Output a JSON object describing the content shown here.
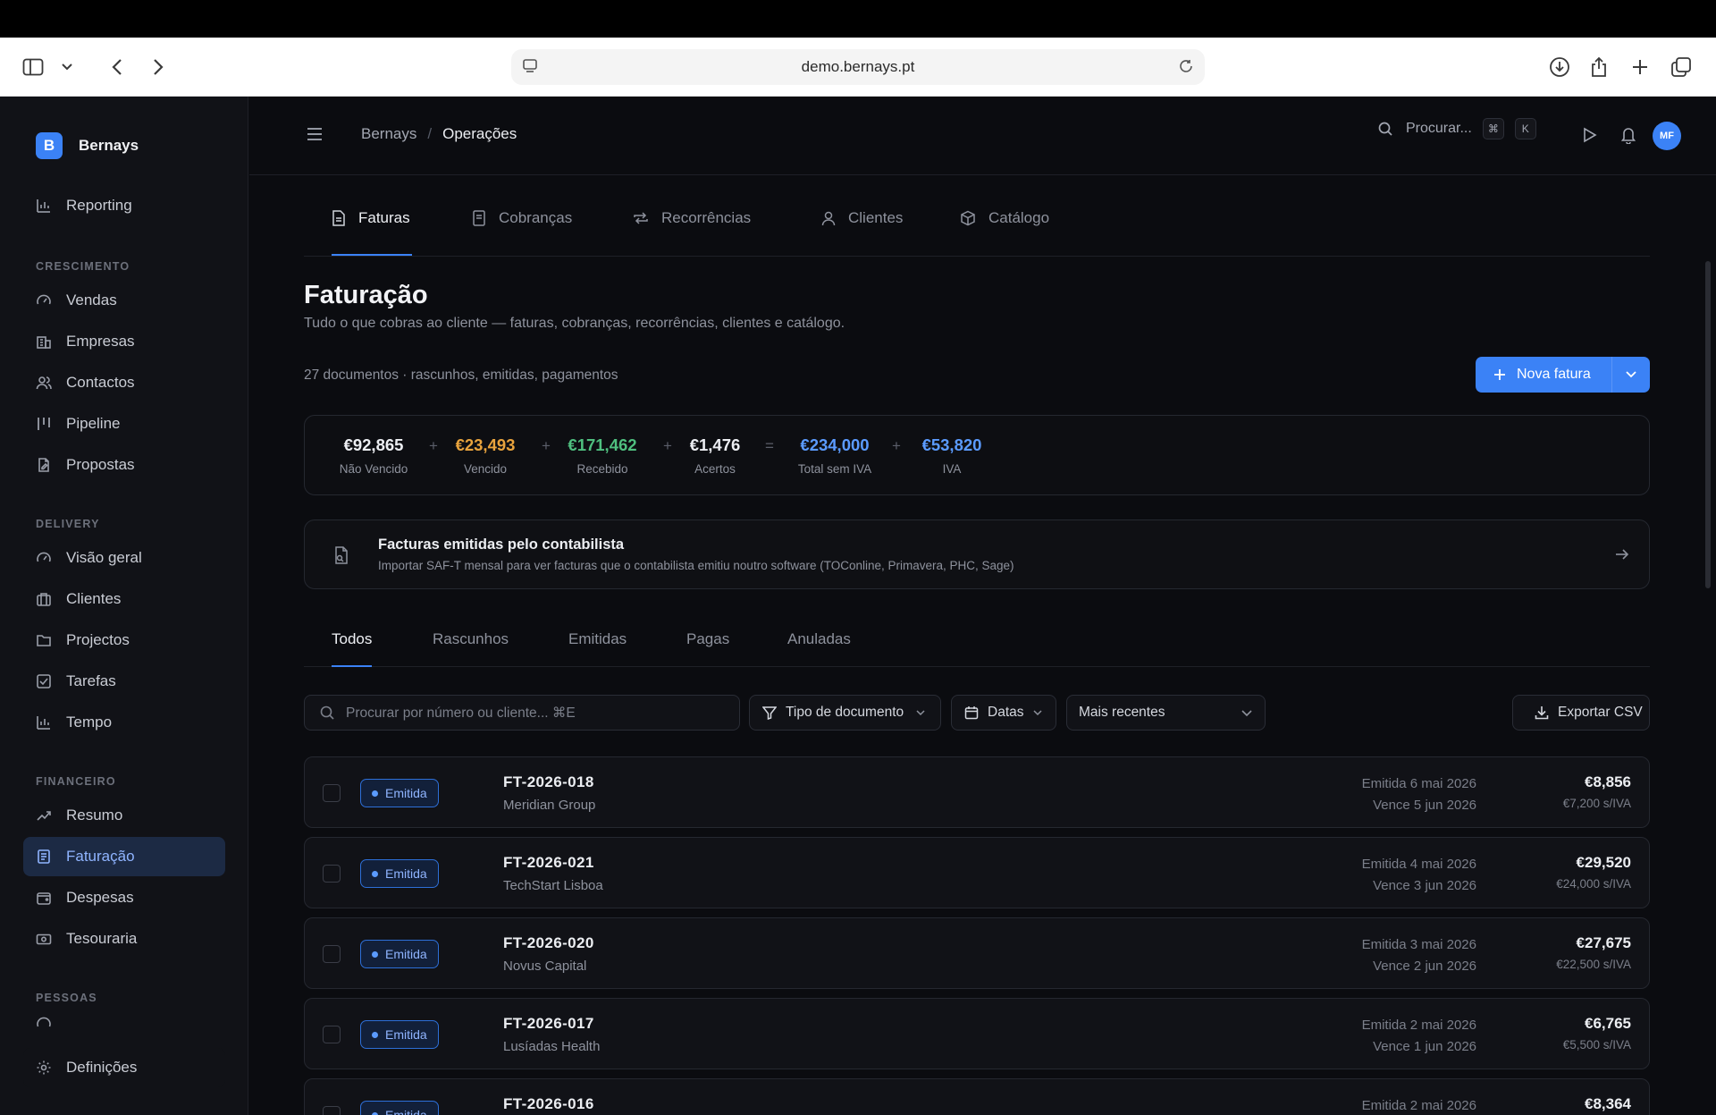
{
  "browser": {
    "url": "demo.bernays.pt"
  },
  "brand": {
    "initial": "B",
    "name": "Bernays"
  },
  "sidebar": {
    "top_items": [
      {
        "label": "Reporting",
        "icon": "bar-chart-icon"
      }
    ],
    "sections": [
      {
        "title": "CRESCIMENTO",
        "items": [
          {
            "label": "Vendas",
            "icon": "gauge-icon"
          },
          {
            "label": "Empresas",
            "icon": "building-icon"
          },
          {
            "label": "Contactos",
            "icon": "users-icon"
          },
          {
            "label": "Pipeline",
            "icon": "kanban-icon"
          },
          {
            "label": "Propostas",
            "icon": "file-edit-icon"
          }
        ]
      },
      {
        "title": "DELIVERY",
        "items": [
          {
            "label": "Visão geral",
            "icon": "gauge-icon"
          },
          {
            "label": "Clientes",
            "icon": "briefcase-icon"
          },
          {
            "label": "Projectos",
            "icon": "folder-icon"
          },
          {
            "label": "Tarefas",
            "icon": "check-square-icon"
          },
          {
            "label": "Tempo",
            "icon": "bar-chart-icon"
          }
        ]
      },
      {
        "title": "FINANCEIRO",
        "items": [
          {
            "label": "Resumo",
            "icon": "trending-up-icon"
          },
          {
            "label": "Faturação",
            "icon": "receipt-icon",
            "active": true
          },
          {
            "label": "Despesas",
            "icon": "wallet-icon"
          },
          {
            "label": "Tesouraria",
            "icon": "banknote-icon"
          }
        ]
      },
      {
        "title": "PESSOAS",
        "items": []
      }
    ],
    "settings": {
      "label": "Definições",
      "icon": "gear-icon"
    }
  },
  "header": {
    "breadcrumb": [
      "Bernays",
      "Operações"
    ],
    "search_placeholder": "Procurar...",
    "shortcut_keys": [
      "⌘",
      "K"
    ],
    "avatar_initials": "MF"
  },
  "top_tabs": [
    {
      "label": "Faturas",
      "icon": "file-text-icon",
      "active": true
    },
    {
      "label": "Cobranças",
      "icon": "receipt-icon"
    },
    {
      "label": "Recorrências",
      "icon": "repeat-icon"
    },
    {
      "label": "Clientes",
      "icon": "user-icon"
    },
    {
      "label": "Catálogo",
      "icon": "package-icon"
    }
  ],
  "page": {
    "title": "Faturação",
    "subtitle": "Tudo o que cobras ao cliente — faturas, cobranças, recorrências, clientes e catálogo.",
    "doc_count": "27 documentos · rascunhos, emitidas, pagamentos",
    "new_button": "Nova fatura"
  },
  "summary": [
    {
      "value": "€92,865",
      "label": "Não Vencido",
      "color": "#eceef2"
    },
    {
      "value": "€23,493",
      "label": "Vencido",
      "color": "#e8a33d"
    },
    {
      "value": "€171,462",
      "label": "Recebido",
      "color": "#4fbf7f"
    },
    {
      "value": "€1,476",
      "label": "Acertos",
      "color": "#eceef2"
    },
    {
      "value": "€234,000",
      "label": "Total sem IVA",
      "color": "#5b9bff"
    },
    {
      "value": "€53,820",
      "label": "IVA",
      "color": "#5b9bff"
    }
  ],
  "summary_ops": [
    "+",
    "+",
    "+",
    "=",
    "+"
  ],
  "saft": {
    "title": "Facturas emitidas pelo contabilista",
    "description": "Importar SAF-T mensal para ver facturas que o contabilista emitiu noutro software (TOConline, Primavera, PHC, Sage)"
  },
  "status_tabs": [
    {
      "label": "Todos",
      "active": true
    },
    {
      "label": "Rascunhos"
    },
    {
      "label": "Emitidas"
    },
    {
      "label": "Pagas"
    },
    {
      "label": "Anuladas"
    }
  ],
  "filters": {
    "search_placeholder": "Procurar por número ou cliente...  ⌘E",
    "doc_type": "Tipo de documento",
    "dates": "Datas",
    "sort": "Mais recentes",
    "export": "Exportar CSV"
  },
  "invoices": [
    {
      "status": "Emitida",
      "number": "FT-2026-018",
      "client": "Meridian Group",
      "issued": "Emitida 6 mai 2026",
      "due": "Vence 5 jun 2026",
      "amount": "€8,856",
      "net": "€7,200 s/IVA"
    },
    {
      "status": "Emitida",
      "number": "FT-2026-021",
      "client": "TechStart Lisboa",
      "issued": "Emitida 4 mai 2026",
      "due": "Vence 3 jun 2026",
      "amount": "€29,520",
      "net": "€24,000 s/IVA"
    },
    {
      "status": "Emitida",
      "number": "FT-2026-020",
      "client": "Novus Capital",
      "issued": "Emitida 3 mai 2026",
      "due": "Vence 2 jun 2026",
      "amount": "€27,675",
      "net": "€22,500 s/IVA"
    },
    {
      "status": "Emitida",
      "number": "FT-2026-017",
      "client": "Lusíadas Health",
      "issued": "Emitida 2 mai 2026",
      "due": "Vence 1 jun 2026",
      "amount": "€6,765",
      "net": "€5,500 s/IVA"
    },
    {
      "status": "Emitida",
      "number": "FT-2026-016",
      "client": "",
      "issued": "Emitida 2 mai 2026",
      "due": "",
      "amount": "€8,364",
      "net": ""
    }
  ]
}
